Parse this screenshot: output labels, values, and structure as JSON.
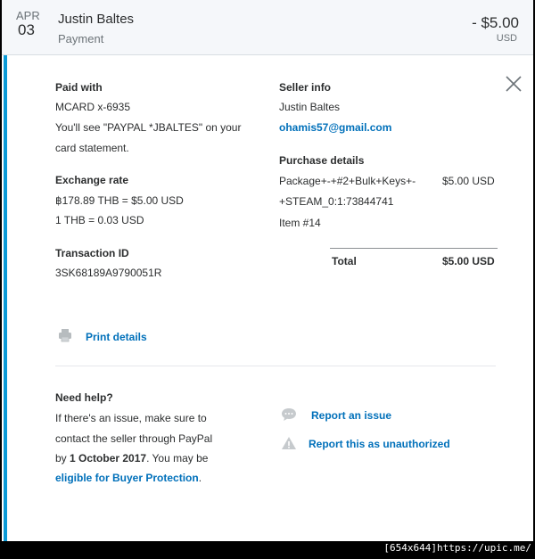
{
  "header": {
    "month": "APR",
    "day": "03",
    "merchant": "Justin Baltes",
    "type": "Payment",
    "amount": "- $5.00",
    "currency": "USD"
  },
  "paid_with": {
    "title": "Paid with",
    "card": "MCARD x-6935",
    "statement_line1": "You'll see \"PAYPAL *JBALTES\" on your",
    "statement_line2": "card statement."
  },
  "exchange": {
    "title": "Exchange rate",
    "rate1": "฿178.89 THB = $5.00 USD",
    "rate2": "1 THB = 0.03 USD"
  },
  "transaction": {
    "title": "Transaction ID",
    "id": "3SK68189A9790051R"
  },
  "seller": {
    "title": "Seller info",
    "name": "Justin Baltes",
    "email": "ohamis57@gmail.com"
  },
  "purchase": {
    "title": "Purchase details",
    "item_line1": "Package+-+#2+Bulk+Keys+-",
    "item_line2": "+STEAM_0:1:73844741",
    "item_number": "Item #14",
    "item_price": "$5.00 USD",
    "total_label": "Total",
    "total_value": "$5.00 USD"
  },
  "print": {
    "label": "Print details",
    "icon": "printer-icon"
  },
  "help": {
    "title": "Need help?",
    "line1": "If there's an issue, make sure to",
    "line2": "contact the seller through PayPal",
    "line3_prefix": "by ",
    "line3_date": "1 October 2017",
    "line3_suffix": ". You may be",
    "protection_link": "eligible for Buyer Protection",
    "protection_suffix": "."
  },
  "actions": {
    "report_issue": "Report an issue",
    "report_unauthorized": "Report this as unauthorized"
  },
  "watermark": "[654x644]https://upic.me/",
  "colors": {
    "accent": "#0b9bd8",
    "link": "#0070ba",
    "header_bg": "#f5f7fa"
  }
}
